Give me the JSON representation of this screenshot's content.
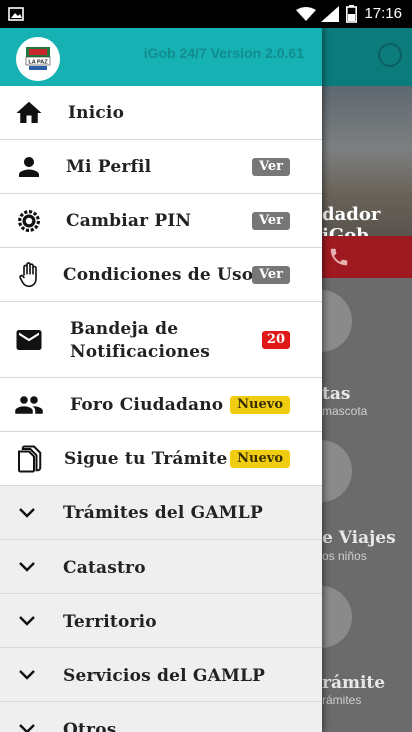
{
  "status_bar": {
    "time": "17:16"
  },
  "header": {
    "version": "iGob 24/7 Version 2.0.61",
    "logo_text": "LA PAZ"
  },
  "menu": [
    {
      "label": "Inicio"
    },
    {
      "label": "Mi Perfil",
      "badge": "Ver"
    },
    {
      "label": "Cambiar PIN",
      "badge": "Ver"
    },
    {
      "label": "Condiciones de Uso",
      "badge": "Ver"
    },
    {
      "label": "Bandeja de Notificaciones",
      "badge": "20"
    },
    {
      "label": "Foro Ciudadano",
      "badge": "Nuevo"
    },
    {
      "label": "Sigue tu Trámite",
      "badge": "Nuevo"
    }
  ],
  "sections": [
    {
      "label": "Trámites del GAMLP"
    },
    {
      "label": "Catastro"
    },
    {
      "label": "Territorio"
    },
    {
      "label": "Servicios del GAMLP"
    },
    {
      "label": "Otros"
    }
  ],
  "background": {
    "banner_text": "dador iGob",
    "items": [
      {
        "label": "tas",
        "sub": "mascota"
      },
      {
        "label": "e Viajes",
        "sub": "os niños"
      },
      {
        "label": "rámite",
        "sub": "rámites"
      }
    ]
  },
  "colors": {
    "header": "#16b1b3",
    "badge_ver": "#777777",
    "badge_red": "#e01818",
    "badge_new": "#f1cd12"
  }
}
